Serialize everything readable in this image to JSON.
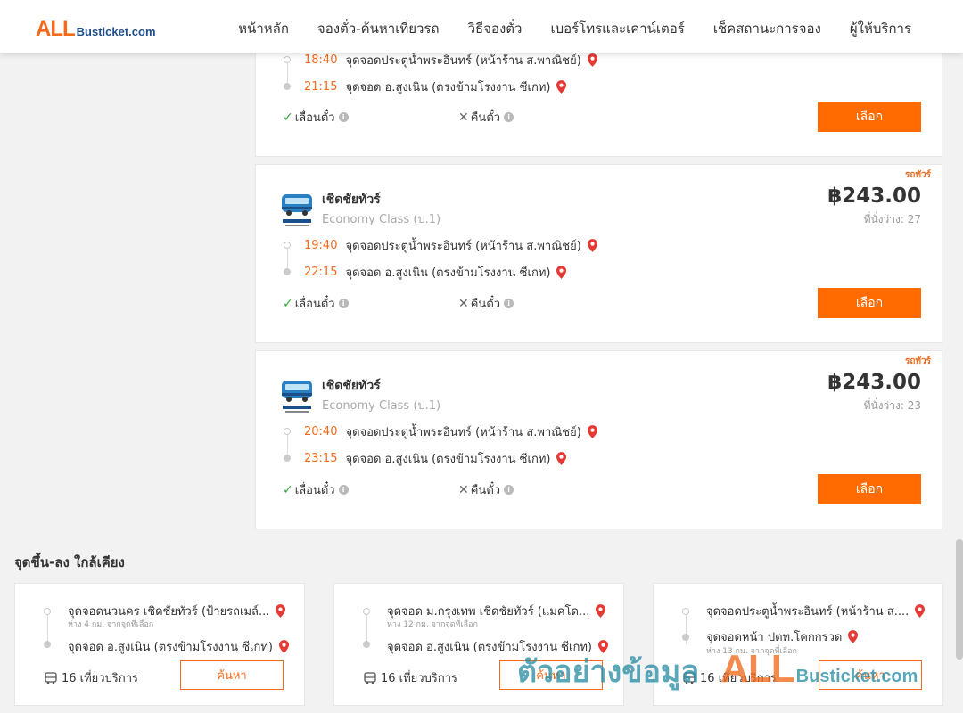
{
  "header": {
    "logo_all": "ALL",
    "logo_site": "Busticket.com",
    "nav": [
      "หน้าหลัก",
      "จองตั๋ว-ค้นหาเที่ยวรถ",
      "วิธีจองตั๋ว",
      "เบอร์โทรและเคาน์เตอร์",
      "เช็คสถานะการจอง",
      "ผู้ให้บริการ"
    ]
  },
  "trips": [
    {
      "depart_time": "18:40",
      "depart_stop": "จุดจอดประตูน้ำพระอินทร์ (หน้าร้าน ส.พาณิชย์)",
      "arrive_time": "21:15",
      "arrive_stop": "จุดจอด อ.สูงเนิน (ตรงข้ามโรงงาน ซีเกท)",
      "reschedule": "เลื่อนตั๋ว",
      "refund": "คืนตั๋ว",
      "select": "เลือก"
    },
    {
      "tag": "รถทัวร์",
      "operator": "เชิดชัยทัวร์",
      "class": "Economy Class (ป.1)",
      "price": "฿243.00",
      "seats": "ที่นั่งว่าง: 27",
      "depart_time": "19:40",
      "depart_stop": "จุดจอดประตูน้ำพระอินทร์ (หน้าร้าน ส.พาณิชย์)",
      "arrive_time": "22:15",
      "arrive_stop": "จุดจอด อ.สูงเนิน (ตรงข้ามโรงงาน ซีเกท)",
      "reschedule": "เลื่อนตั๋ว",
      "refund": "คืนตั๋ว",
      "select": "เลือก"
    },
    {
      "tag": "รถทัวร์",
      "operator": "เชิดชัยทัวร์",
      "class": "Economy Class (ป.1)",
      "price": "฿243.00",
      "seats": "ที่นั่งว่าง: 23",
      "depart_time": "20:40",
      "depart_stop": "จุดจอดประตูน้ำพระอินทร์ (หน้าร้าน ส.พาณิชย์)",
      "arrive_time": "23:15",
      "arrive_stop": "จุดจอด อ.สูงเนิน (ตรงข้ามโรงงาน ซีเกท)",
      "reschedule": "เลื่อนตั๋ว",
      "refund": "คืนตั๋ว",
      "select": "เลือก"
    }
  ],
  "nearby": {
    "title": "จุดขึ้น-ลง ใกล้เคียง",
    "items": [
      {
        "from": "จุดจอดนวนคร เชิดชัยทัวร์ (ป้ายรถเมล์...",
        "from_dist": "ห่าง 4 กม. จากจุดที่เลือก",
        "to": "จุดจอด อ.สูงเนิน (ตรงข้ามโรงงาน ซีเกท)",
        "to_dist": "",
        "trips": "16 เที่ยวบริการ",
        "button": "ค้นหา"
      },
      {
        "from": "จุดจอด ม.กรุงเทพ เชิดชัยทัวร์ (แมคโด...",
        "from_dist": "ห่าง 12 กม. จากจุดที่เลือก",
        "to": "จุดจอด อ.สูงเนิน (ตรงข้ามโรงงาน ซีเกท)",
        "to_dist": "",
        "trips": "16 เที่ยวบริการ",
        "button": "ค้นหา"
      },
      {
        "from": "จุดจอดประตูน้ำพระอินทร์ (หน้าร้าน ส....",
        "from_dist": "",
        "to": "จุดจอดหน้า ปตท.โคกกรวด",
        "to_dist": "ห่าง 13 กม. จากจุดที่เลือก",
        "trips": "16 เที่ยวบริการ",
        "button": "ค้นหา"
      }
    ]
  },
  "watermark": {
    "thai": "ตัวอย่างข้อมูล",
    "all": "ALL",
    "site": "Busticket.com"
  },
  "colors": {
    "accent": "#ff6b00",
    "time": "#f26b1d",
    "ok": "#3aa53a",
    "pin": "#e53935"
  }
}
